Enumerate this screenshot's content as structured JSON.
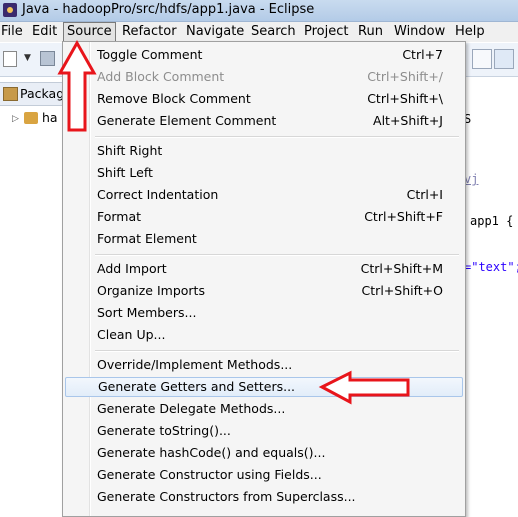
{
  "window": {
    "title": "Java - hadoopPro/src/hdfs/app1.java - Eclipse"
  },
  "menubar": {
    "items": [
      "File",
      "Edit",
      "Source",
      "Refactor",
      "Navigate",
      "Search",
      "Project",
      "Run",
      "Window",
      "Help"
    ],
    "active": "Source"
  },
  "left_panel": {
    "tab_label": "Packag",
    "tree_item": "ha"
  },
  "editor": {
    "fragments": [
      "vj",
      "app1 {",
      "=\"text\";",
      "S"
    ]
  },
  "source_menu": {
    "groups": [
      [
        {
          "label": "Toggle Comment",
          "shortcut": "Ctrl+7",
          "enabled": true
        },
        {
          "label": "Add Block Comment",
          "shortcut": "Ctrl+Shift+/",
          "enabled": false
        },
        {
          "label": "Remove Block Comment",
          "shortcut": "Ctrl+Shift+\\",
          "enabled": true
        },
        {
          "label": "Generate Element Comment",
          "shortcut": "Alt+Shift+J",
          "enabled": true
        }
      ],
      [
        {
          "label": "Shift Right",
          "shortcut": "",
          "enabled": true
        },
        {
          "label": "Shift Left",
          "shortcut": "",
          "enabled": true
        },
        {
          "label": "Correct Indentation",
          "shortcut": "Ctrl+I",
          "enabled": true
        },
        {
          "label": "Format",
          "shortcut": "Ctrl+Shift+F",
          "enabled": true
        },
        {
          "label": "Format Element",
          "shortcut": "",
          "enabled": true
        }
      ],
      [
        {
          "label": "Add Import",
          "shortcut": "Ctrl+Shift+M",
          "enabled": true
        },
        {
          "label": "Organize Imports",
          "shortcut": "Ctrl+Shift+O",
          "enabled": true
        },
        {
          "label": "Sort Members...",
          "shortcut": "",
          "enabled": true
        },
        {
          "label": "Clean Up...",
          "shortcut": "",
          "enabled": true
        }
      ],
      [
        {
          "label": "Override/Implement Methods...",
          "shortcut": "",
          "enabled": true
        },
        {
          "label": "Generate Getters and Setters...",
          "shortcut": "",
          "enabled": true,
          "highlighted": true
        },
        {
          "label": "Generate Delegate Methods...",
          "shortcut": "",
          "enabled": true
        },
        {
          "label": "Generate toString()...",
          "shortcut": "",
          "enabled": true
        },
        {
          "label": "Generate hashCode() and equals()...",
          "shortcut": "",
          "enabled": true
        },
        {
          "label": "Generate Constructor using Fields...",
          "shortcut": "",
          "enabled": true
        },
        {
          "label": "Generate Constructors from Superclass...",
          "shortcut": "",
          "enabled": true
        }
      ]
    ]
  },
  "annotations": {
    "arrow_color": "#e8151b",
    "arrows": [
      "up-arrow-to-source-menu",
      "left-arrow-to-generate-getters-setters"
    ]
  },
  "colors": {
    "titlebar": "#c3d6ee",
    "menu_bg": "#f5f5f5",
    "highlight": "#dce9f8",
    "string_literal": "#2a00ff"
  }
}
